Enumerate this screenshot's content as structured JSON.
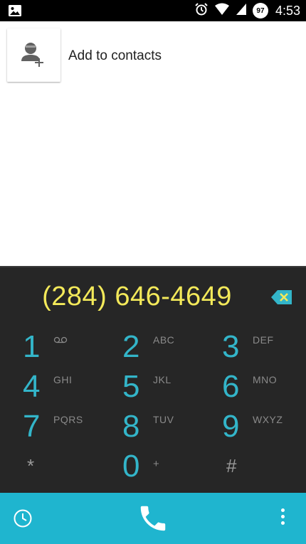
{
  "status_bar": {
    "time": "4:53",
    "battery": "97",
    "icons": [
      "image-icon",
      "alarm-icon",
      "wifi-icon",
      "signal-icon"
    ]
  },
  "contacts": {
    "add_label": "Add to contacts",
    "icon": "add-person-icon"
  },
  "dialpad": {
    "number": "(284) 646-4649",
    "number_color": "#f3e95a",
    "digit_color": "#33b5c9",
    "keys": [
      {
        "digit": "1",
        "letters": ""
      },
      {
        "digit": "2",
        "letters": "ABC"
      },
      {
        "digit": "3",
        "letters": "DEF"
      },
      {
        "digit": "4",
        "letters": "GHI"
      },
      {
        "digit": "5",
        "letters": "JKL"
      },
      {
        "digit": "6",
        "letters": "MNO"
      },
      {
        "digit": "7",
        "letters": "PQRS"
      },
      {
        "digit": "8",
        "letters": "TUV"
      },
      {
        "digit": "9",
        "letters": "WXYZ"
      },
      {
        "digit": "*",
        "letters": ""
      },
      {
        "digit": "0",
        "letters": "+"
      },
      {
        "digit": "#",
        "letters": ""
      }
    ]
  },
  "bottom_bar": {
    "color": "#1fb5cf",
    "icons": [
      "history-icon",
      "phone-icon",
      "more-vert-icon"
    ]
  }
}
